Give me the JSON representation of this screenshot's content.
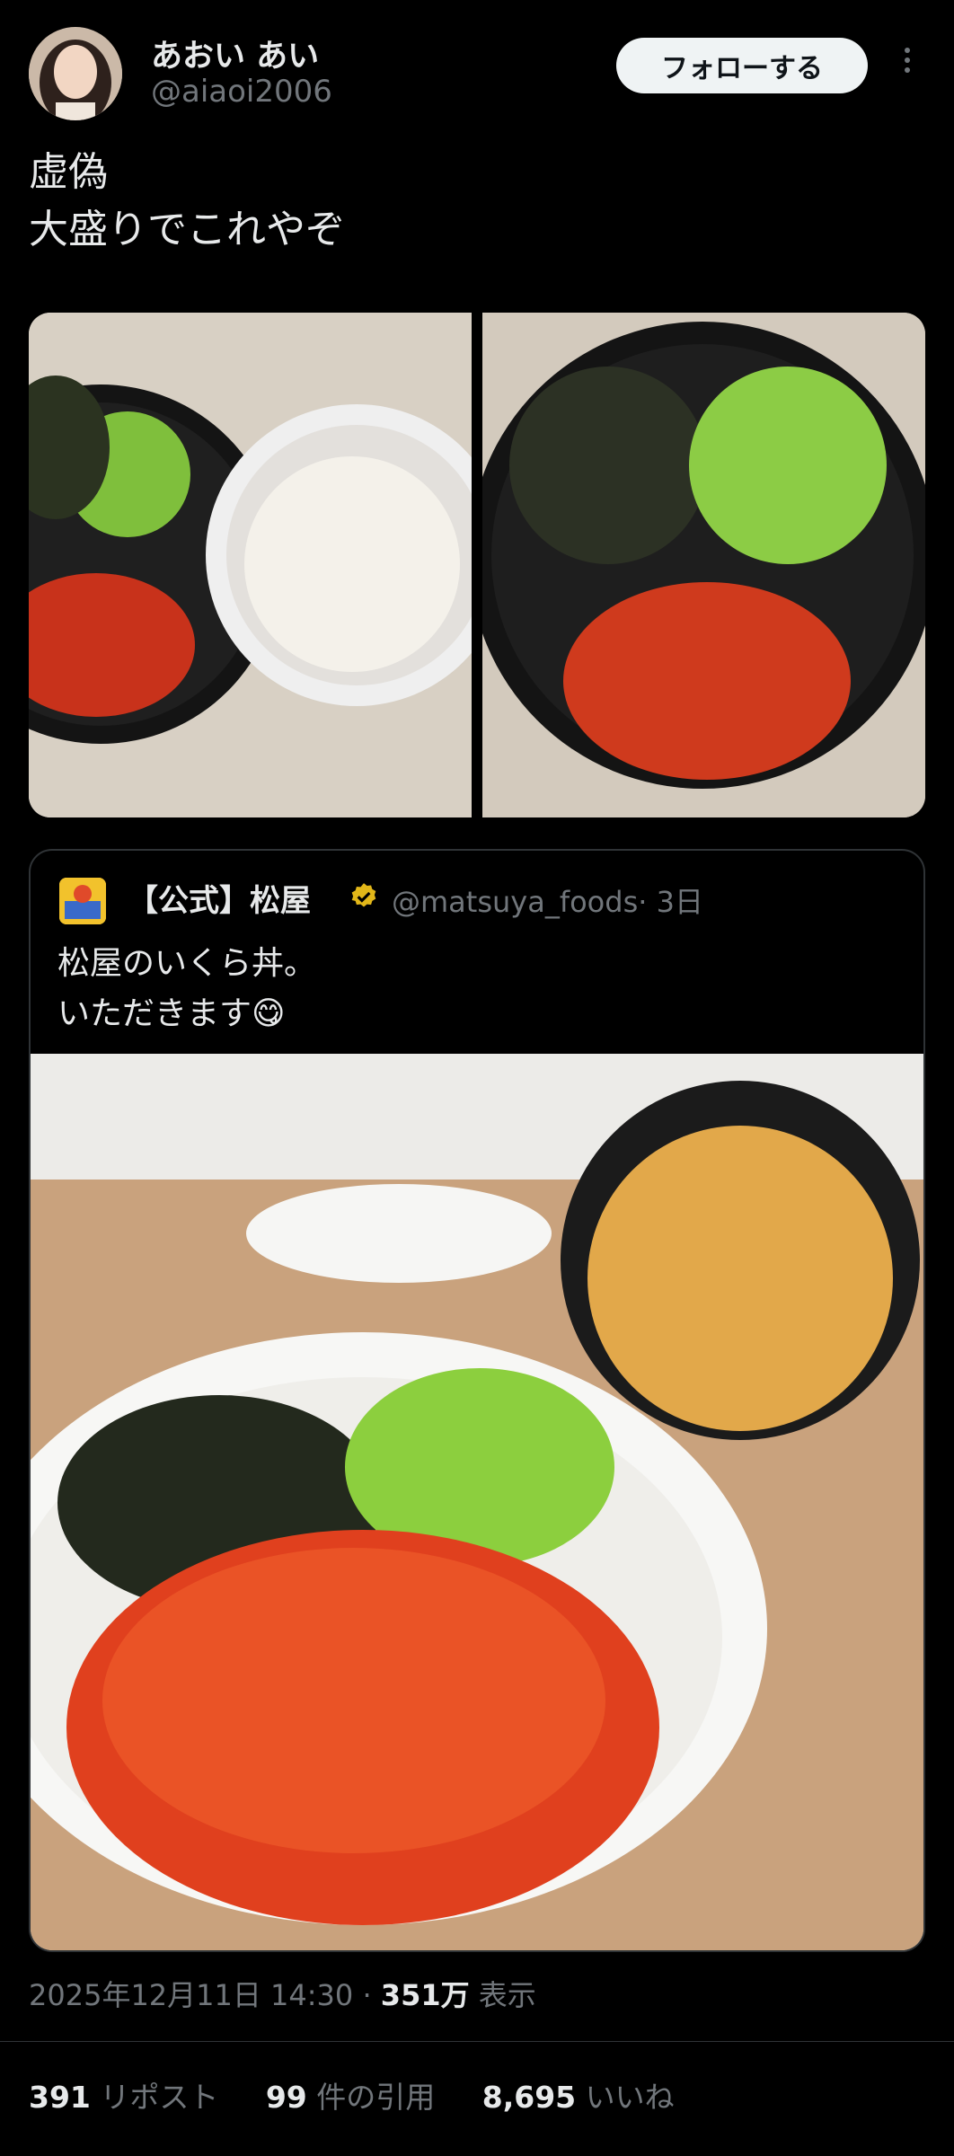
{
  "post": {
    "author_name": "あおい あい",
    "author_handle": "@aiaoi2006",
    "follow_label": "フォローする",
    "text": "虚偽\n大盛りでこれやぞ",
    "timestamp": "2025年12月11日 14:30",
    "separator": "·",
    "views_count": "351万",
    "views_label": "表示"
  },
  "quote": {
    "name": "【公式】松屋",
    "handle": "@matsuya_foods",
    "time": "· 3日",
    "text": "松屋のいくら丼。\nいただきます😋"
  },
  "stats": {
    "reposts_count": "391",
    "reposts_label": "リポスト",
    "quotes_count": "99",
    "quotes_label": "件の引用",
    "likes_count": "8,695",
    "likes_label": "いいね"
  },
  "icons": {
    "more": "more-vertical-icon",
    "verified": "verified-badge-icon"
  },
  "colors": {
    "background": "#000000",
    "text": "#e7e9ea",
    "muted": "#71767b",
    "border": "#2f3336",
    "verified_gold": "#e2b719"
  }
}
